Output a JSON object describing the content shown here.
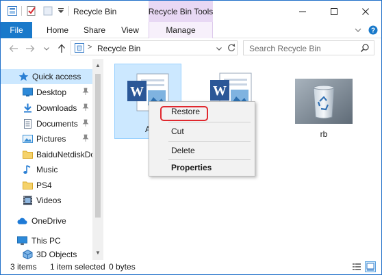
{
  "window": {
    "title": "Recycle Bin",
    "contextual_tab_group": "Recycle Bin Tools",
    "quick_access_toolbar": [
      "properties-icon",
      "checkmark-icon",
      "new-folder-icon",
      "customize-toolbar-icon"
    ],
    "controls": [
      "minimize-icon",
      "maximize-icon",
      "close-icon"
    ]
  },
  "ribbon": {
    "tabs": [
      {
        "label": "File",
        "active": true
      },
      {
        "label": "Home"
      },
      {
        "label": "Share"
      },
      {
        "label": "View"
      },
      {
        "label": "Manage",
        "contextual": true
      }
    ]
  },
  "address": {
    "path_separator": ">",
    "location": "Recycle Bin",
    "search_placeholder": "Search Recycle Bin"
  },
  "nav": {
    "items": [
      {
        "label": "Quick access",
        "icon": "star-icon",
        "selected": true
      },
      {
        "label": "Desktop",
        "icon": "desktop-icon",
        "pinned": true
      },
      {
        "label": "Downloads",
        "icon": "download-icon",
        "pinned": true
      },
      {
        "label": "Documents",
        "icon": "documents-icon",
        "pinned": true
      },
      {
        "label": "Pictures",
        "icon": "pictures-icon",
        "pinned": true
      },
      {
        "label": "BaiduNetdiskDo",
        "icon": "folder-icon"
      },
      {
        "label": "Music",
        "icon": "music-icon"
      },
      {
        "label": "PS4",
        "icon": "folder-icon"
      },
      {
        "label": "Videos",
        "icon": "videos-icon"
      },
      {
        "label": "OneDrive",
        "icon": "cloud-icon"
      },
      {
        "label": "This PC",
        "icon": "computer-icon"
      },
      {
        "label": "3D Objects",
        "icon": "cube-icon"
      }
    ]
  },
  "files": [
    {
      "label": "A",
      "icon": "word-document-icon",
      "selected": true
    },
    {
      "label": "",
      "icon": "word-document-icon"
    },
    {
      "label": "rb",
      "icon": "recycle-bin-image-icon"
    }
  ],
  "context_menu": {
    "items": [
      {
        "label": "Restore",
        "highlighted": true
      },
      {
        "label": "Cut"
      },
      {
        "label": "Delete"
      },
      {
        "label": "Properties",
        "bold": true
      }
    ]
  },
  "status": {
    "item_count": "3 items",
    "selection": "1 item selected",
    "size": "0 bytes"
  },
  "colors": {
    "accent": "#1979ca",
    "contextual_tab": "#e8d8f4",
    "selection": "#cce8ff",
    "highlight_ring": "#e0282e"
  }
}
